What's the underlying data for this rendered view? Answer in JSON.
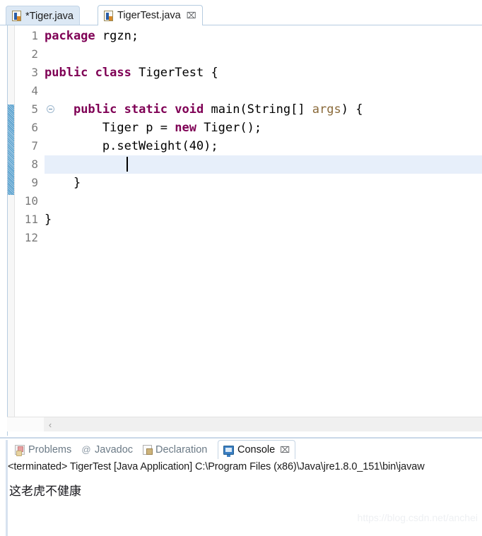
{
  "editor": {
    "tabs": [
      {
        "label": "*Tiger.java",
        "icon": "java-file-icon",
        "active": false,
        "closable": false
      },
      {
        "label": "TigerTest.java",
        "icon": "java-file-icon",
        "active": true,
        "closable": true,
        "close_glyph": "⌧"
      }
    ],
    "gutter": {
      "line_numbers": [
        "1",
        "2",
        "3",
        "4",
        "5",
        "6",
        "7",
        "8",
        "9",
        "10",
        "11",
        "12"
      ],
      "fold_marker_line": 5
    },
    "current_line": 8,
    "cursor_line": 8,
    "code_lines": [
      {
        "n": 1,
        "tokens": [
          {
            "t": "package",
            "c": "kw"
          },
          {
            "t": " rgzn;",
            "c": "plain"
          }
        ]
      },
      {
        "n": 2,
        "tokens": []
      },
      {
        "n": 3,
        "tokens": [
          {
            "t": "public",
            "c": "kw"
          },
          {
            "t": " ",
            "c": "plain"
          },
          {
            "t": "class",
            "c": "kw"
          },
          {
            "t": " TigerTest {",
            "c": "plain"
          }
        ]
      },
      {
        "n": 4,
        "tokens": []
      },
      {
        "n": 5,
        "tokens": [
          {
            "t": "    ",
            "c": "plain"
          },
          {
            "t": "public",
            "c": "kw"
          },
          {
            "t": " ",
            "c": "plain"
          },
          {
            "t": "static",
            "c": "kw"
          },
          {
            "t": " ",
            "c": "plain"
          },
          {
            "t": "void",
            "c": "kw"
          },
          {
            "t": " main(String[] ",
            "c": "plain"
          },
          {
            "t": "args",
            "c": "par"
          },
          {
            "t": ") {",
            "c": "plain"
          }
        ]
      },
      {
        "n": 6,
        "tokens": [
          {
            "t": "        Tiger p = ",
            "c": "plain"
          },
          {
            "t": "new",
            "c": "kw"
          },
          {
            "t": " Tiger();",
            "c": "plain"
          }
        ]
      },
      {
        "n": 7,
        "tokens": [
          {
            "t": "        p.setWeight(40);",
            "c": "plain"
          }
        ]
      },
      {
        "n": 8,
        "tokens": [
          {
            "t": "        ",
            "c": "plain"
          }
        ]
      },
      {
        "n": 9,
        "tokens": [
          {
            "t": "    }",
            "c": "plain"
          }
        ]
      },
      {
        "n": 10,
        "tokens": []
      },
      {
        "n": 11,
        "tokens": [
          {
            "t": "}",
            "c": "plain"
          }
        ]
      },
      {
        "n": 12,
        "tokens": []
      }
    ],
    "scrollbar": {
      "left_arrow_glyph": "‹"
    }
  },
  "console_panel": {
    "tabs": [
      {
        "label": "Problems",
        "icon": "problems-icon",
        "active": false,
        "closable": false
      },
      {
        "label": "Javadoc",
        "icon": "javadoc-icon",
        "active": false,
        "closable": false
      },
      {
        "label": "Declaration",
        "icon": "declaration-icon",
        "active": false,
        "closable": false
      },
      {
        "label": "Console",
        "icon": "console-icon",
        "active": true,
        "closable": true,
        "close_glyph": "⌧"
      }
    ],
    "terminated_line": "<terminated> TigerTest [Java Application] C:\\Program Files (x86)\\Java\\jre1.8.0_151\\bin\\javaw",
    "output": "这老虎不健康"
  },
  "watermark": {
    "text": "https://blog.csdn.net/anchei"
  },
  "colors": {
    "keyword": "#7f0055",
    "parameter": "#8a6a3a",
    "current_line_highlight": "#e7effa",
    "tab_inactive_bg": "#dce8f4",
    "tab_border": "#b6cce0",
    "change_bar": "#5ea6d0",
    "console_icon_blue": "#3b7fc4"
  }
}
